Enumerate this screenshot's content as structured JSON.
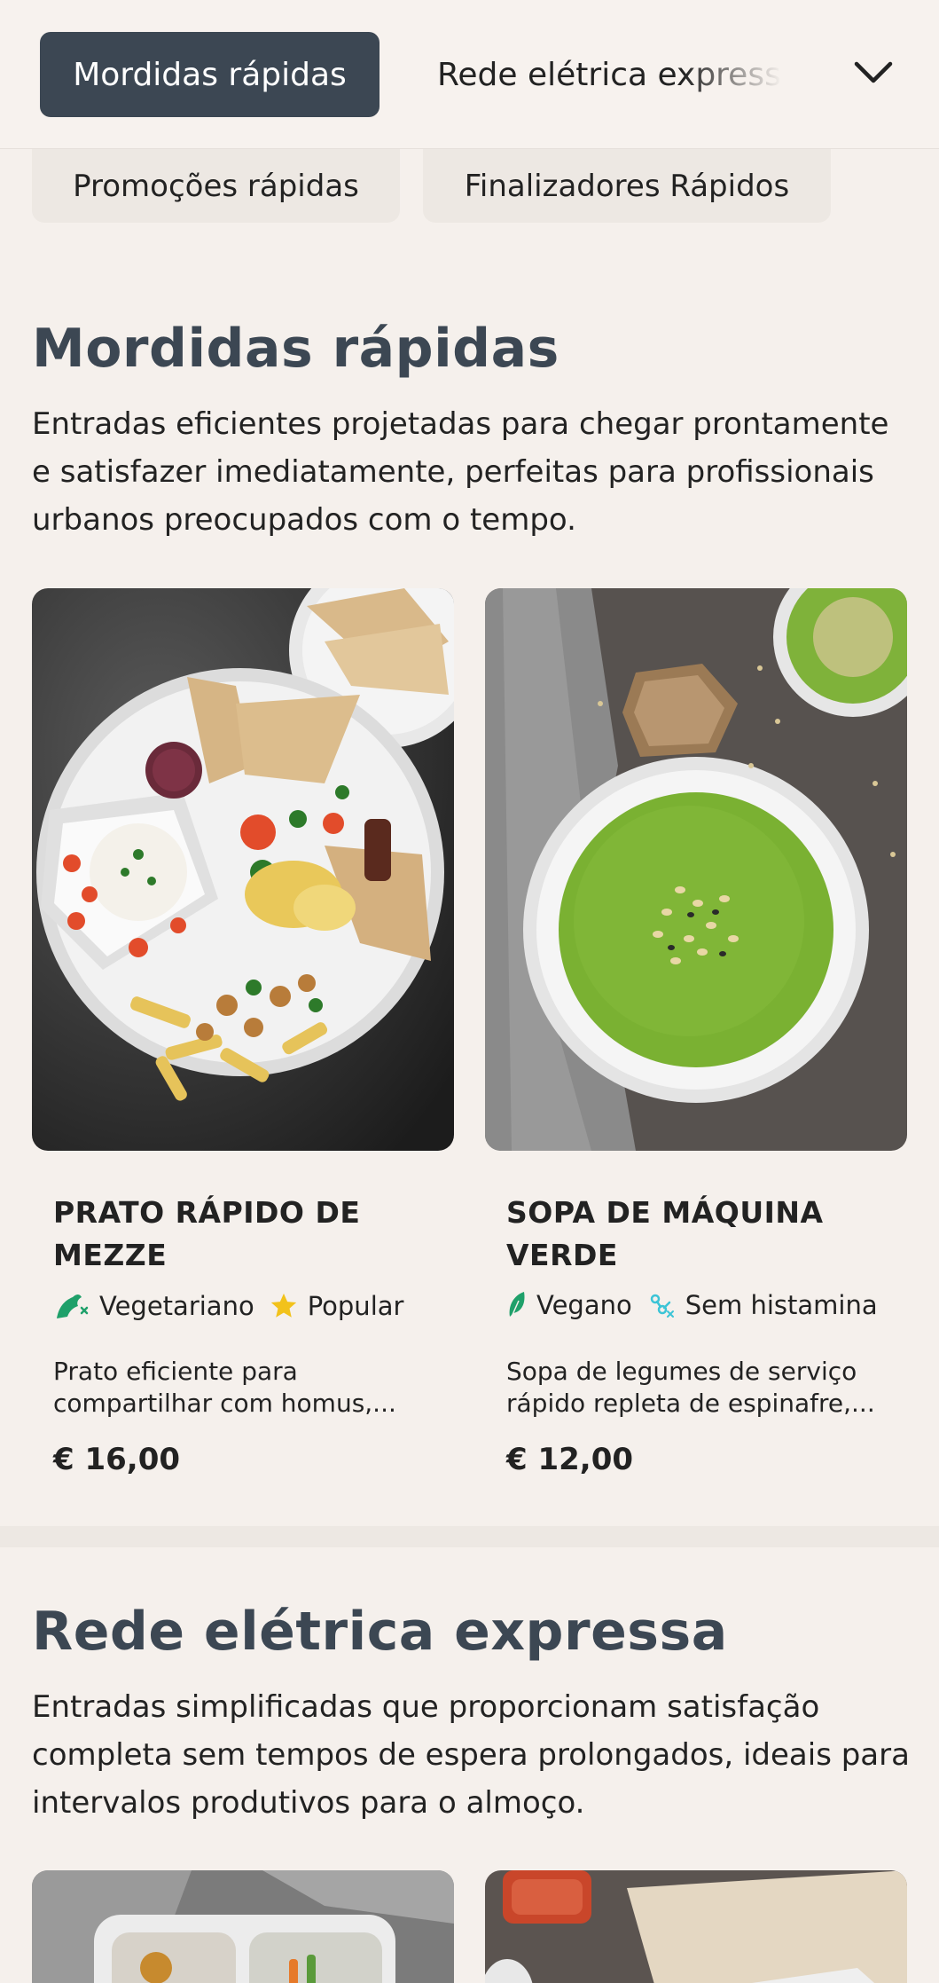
{
  "nav": {
    "active_tab": "Mordidas rápidas",
    "next_tab": "Rede elétrica expressa",
    "subtabs": [
      "Promoções rápidas",
      "Finalizadores Rápidos"
    ]
  },
  "sections": [
    {
      "title": "Mordidas rápidas",
      "description": "Entradas eficientes projetadas para chegar prontamente e satisfazer imediatamente, perfeitas para profissionais urbanos preocupados com o tempo.",
      "items": [
        {
          "name": "PRATO RÁPIDO DE MEZZE",
          "tags": [
            {
              "label": "Vegetariano",
              "icon": "vegetarian-icon",
              "color": "#1fa06a"
            },
            {
              "label": "Popular",
              "icon": "star-icon",
              "color": "#f2c21b"
            }
          ],
          "description": "Prato eficiente para compartilhar com homus,...",
          "price": "€ 16,00"
        },
        {
          "name": "SOPA DE MÁQUINA VERDE",
          "tags": [
            {
              "label": "Vegano",
              "icon": "leaf-icon",
              "color": "#1fa06a"
            },
            {
              "label": "Sem histamina",
              "icon": "histamine-free-icon",
              "color": "#3cc4d6"
            }
          ],
          "description": "Sopa de legumes de serviço rápido repleta de espinafre,...",
          "price": "€ 12,00"
        }
      ]
    },
    {
      "title": "Rede elétrica expressa",
      "description": "Entradas simplificadas que proporcionam satisfação completa sem tempos de espera prolongados, ideais para intervalos produtivos para o almoço."
    }
  ]
}
